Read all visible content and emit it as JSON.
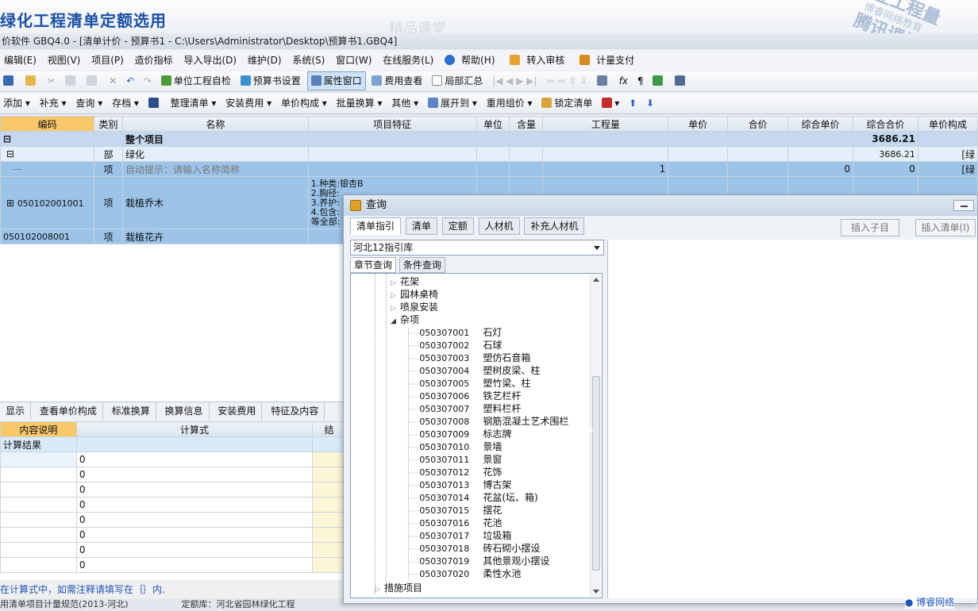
{
  "banner": {
    "title": "绿化工程清单定额选用",
    "faint_text": "精品课堂",
    "watermark_big": "专业工程量",
    "watermark_small": "博睿网络教育",
    "watermark_mid": "腾讯课堂"
  },
  "window": {
    "title": "价软件 GBQ4.0 - [清单计价 - 预算书1 - C:\\Users\\Administrator\\Desktop\\预算书1.GBQ4]"
  },
  "menu": [
    "编辑(E)",
    "视图(V)",
    "项目(P)",
    "造价指标",
    "导入导出(D)",
    "维护(D)",
    "系统(S)",
    "窗口(W)",
    "在线服务(L)",
    "帮助(H)",
    "转入审核",
    "计量支付"
  ],
  "toolbar1": {
    "self_check": "单位工程自检",
    "budget_settings": "预算书设置",
    "property_window": "属性窗口",
    "fee_view": "费用查看",
    "partial_summary": "局部汇总"
  },
  "toolbar2": [
    "添加",
    "补充",
    "查询",
    "存档",
    "整理清单",
    "安装费用",
    "单价构成",
    "批量换算",
    "其他",
    "展开到",
    "重用组价",
    "锁定清单"
  ],
  "grid": {
    "columns": [
      "编码",
      "类别",
      "名称",
      "项目特征",
      "单位",
      "含量",
      "工程量",
      "单价",
      "合价",
      "综合单价",
      "综合合价",
      "单价构成"
    ],
    "rows": [
      {
        "code": "",
        "type": "",
        "name": "整个项目",
        "feature": "",
        "unit": "",
        "qty_ratio": "",
        "quantity": "",
        "price": "",
        "total": "",
        "comp_price": "",
        "comp_total": "3686.21",
        "composition": ""
      },
      {
        "code": "",
        "type": "部",
        "name": "绿化",
        "feature": "",
        "unit": "",
        "qty_ratio": "",
        "quantity": "",
        "price": "",
        "total": "",
        "comp_price": "",
        "comp_total": "3686.21",
        "composition": "[绿"
      },
      {
        "code": "",
        "type": "项",
        "name": "自动提示：请输入名称简称",
        "feature": "",
        "unit": "",
        "qty_ratio": "",
        "quantity": "1",
        "price": "",
        "total": "",
        "comp_price": "0",
        "comp_total": "0",
        "composition": "[绿"
      },
      {
        "code": "050102001001",
        "type": "项",
        "name": "栽植乔木",
        "feature_lines": [
          "1.种类:银杏B",
          "2.胸径:",
          "3.养护:",
          "4.包含:",
          "等全部:"
        ],
        "unit": "",
        "qty_ratio": "",
        "quantity": "",
        "price": "",
        "total": "",
        "comp_price": "",
        "comp_total": "",
        "composition": ""
      },
      {
        "code": "050102008001",
        "type": "项",
        "name": "栽植花卉",
        "feature": "",
        "unit": "",
        "qty_ratio": "",
        "quantity": "",
        "price": "",
        "total": "",
        "comp_price": "",
        "comp_total": "",
        "composition": ""
      }
    ]
  },
  "lower": {
    "tabs": [
      "显示",
      "查看单价构成",
      "标准换算",
      "换算信息",
      "安装费用",
      "特征及内容"
    ],
    "columns": [
      "内容说明",
      "计算式",
      "结"
    ],
    "result_label": "计算结果",
    "values": [
      "0",
      "0",
      "0",
      "0",
      "0",
      "0",
      "0",
      "0"
    ],
    "hint": "在计算式中，如需注释请填写在｛｝内.",
    "status_left": "用清单项目计量规范(2013-河北)",
    "status_mid": "定额库：河北省园林绿化工程"
  },
  "dialog": {
    "title": "查询",
    "tabs": [
      "清单指引",
      "清单",
      "定额",
      "人材机",
      "补充人材机"
    ],
    "btn_insert_child": "插入子目",
    "btn_insert_list": "插入清单(I)",
    "library": "河北12指引库",
    "subtabs": [
      "章节查询",
      "条件查询"
    ],
    "tree_top": [
      {
        "label": "花架",
        "expanded": false
      },
      {
        "label": "园林桌椅",
        "expanded": false
      },
      {
        "label": "喷泉安装",
        "expanded": false
      },
      {
        "label": "杂项",
        "expanded": true
      }
    ],
    "items": [
      {
        "code": "050307001",
        "name": "石灯"
      },
      {
        "code": "050307002",
        "name": "石球"
      },
      {
        "code": "050307003",
        "name": "塑仿石音箱"
      },
      {
        "code": "050307004",
        "name": "塑树皮梁、柱"
      },
      {
        "code": "050307005",
        "name": "塑竹梁、柱"
      },
      {
        "code": "050307006",
        "name": "铁艺栏杆"
      },
      {
        "code": "050307007",
        "name": "塑料栏杆"
      },
      {
        "code": "050307008",
        "name": "钢筋混凝土艺术围栏"
      },
      {
        "code": "050307009",
        "name": "标志牌"
      },
      {
        "code": "050307010",
        "name": "景墙"
      },
      {
        "code": "050307011",
        "name": "景窗"
      },
      {
        "code": "050307012",
        "name": "花饰"
      },
      {
        "code": "050307013",
        "name": "博古架"
      },
      {
        "code": "050307014",
        "name": "花盆(坛、箱)"
      },
      {
        "code": "050307015",
        "name": "摆花"
      },
      {
        "code": "050307016",
        "name": "花池"
      },
      {
        "code": "050307017",
        "name": "垃圾箱"
      },
      {
        "code": "050307018",
        "name": "砖石砌小摆设"
      },
      {
        "code": "050307019",
        "name": "其他景观小摆设"
      },
      {
        "code": "050307020",
        "name": "柔性水池"
      }
    ],
    "tree_bottom": "措施项目"
  },
  "brand": "博睿网络"
}
